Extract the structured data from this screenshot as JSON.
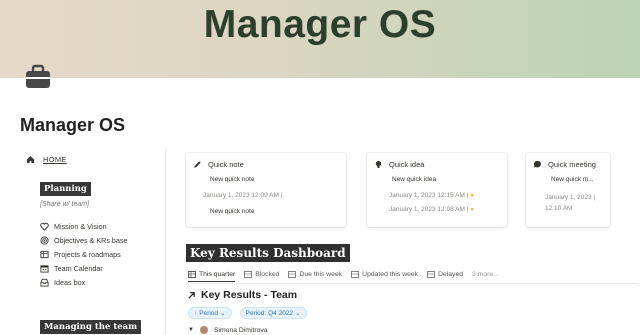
{
  "cover": {
    "title": "Manager OS"
  },
  "page": {
    "title": "Manager OS",
    "icon": "briefcase-icon"
  },
  "sidebar": {
    "home_label": "HOME",
    "planning_heading": "Planning",
    "share_note": "[Share w/ team]",
    "links": [
      {
        "label": "Mission & Vision",
        "icon": "heart-icon"
      },
      {
        "label": "Objectives & KRs base",
        "icon": "target-icon"
      },
      {
        "label": "Projects & roadmaps",
        "icon": "table-icon"
      },
      {
        "label": "Team Calendar",
        "icon": "calendar-icon"
      },
      {
        "label": "Ideas box",
        "icon": "inbox-icon"
      }
    ],
    "managing_heading": "Managing the team"
  },
  "cards": {
    "quick_note": {
      "title": "Quick note",
      "icon": "pencil-icon",
      "entries": [
        "New quick note",
        "New quick note"
      ],
      "timestamp": "January 1, 2023 12:09 AM"
    },
    "quick_idea": {
      "title": "Quick idea",
      "icon": "lightbulb-icon",
      "entry": "New quick idea",
      "timestamps": [
        "January 1, 2023 12:15 AM",
        "January 1, 2023 12:08 AM"
      ]
    },
    "quick_meeting": {
      "title": "Quick meeting",
      "icon": "speech-bubble-icon",
      "entry": "New quick m...",
      "date": "January 1, 2023",
      "time": "12:10 AM"
    }
  },
  "dashboard": {
    "title": "Key Results Dashboard",
    "tabs": [
      {
        "label": "This quarter",
        "active": true
      },
      {
        "label": "Blocked",
        "active": false
      },
      {
        "label": "Due this week",
        "active": false
      },
      {
        "label": "Updated this week",
        "active": false
      },
      {
        "label": "Delayed",
        "active": false
      }
    ],
    "more_label": "3 more...",
    "kr_title": "Key Results - Team",
    "filters": {
      "period_label": "Period",
      "period_value_label": "Period:",
      "period_value": "Q4 2022"
    },
    "group_name": "Simona Dimitrova"
  },
  "colors": {
    "cover_start": "#e6d9c8",
    "cover_end": "#bcd3b3",
    "chip_blue": "#2b74b8"
  }
}
